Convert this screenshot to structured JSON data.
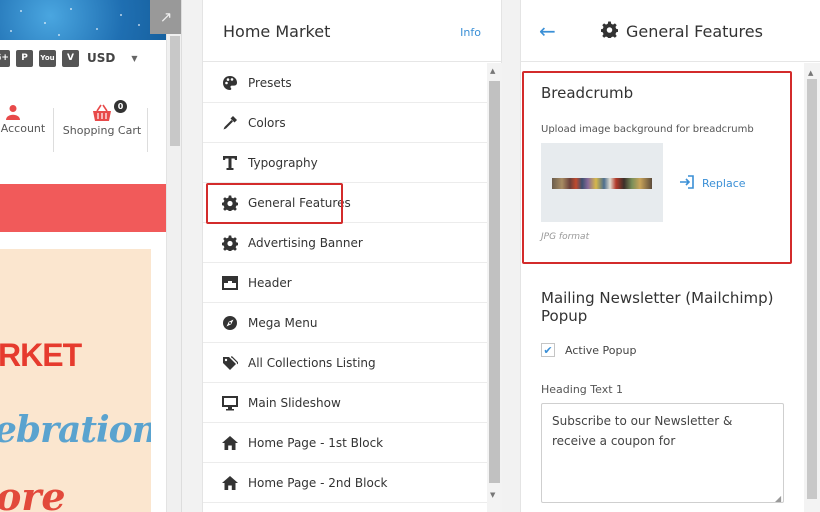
{
  "preview": {
    "expand_icon": "expand-arrow-icon",
    "currency": "USD",
    "social_icons": [
      "google-plus-icon",
      "pinterest-icon",
      "youtube-icon",
      "vimeo-icon"
    ],
    "account_label": "Account",
    "cart_label": "Shopping Cart",
    "cart_count": "0",
    "poster": {
      "line1": "RKET",
      "line2": "ebration",
      "line3": "ore"
    }
  },
  "menu": {
    "title": "Home Market",
    "info_link": "Info",
    "items": [
      {
        "label": "Presets",
        "icon": "palette-icon"
      },
      {
        "label": "Colors",
        "icon": "eyedropper-icon"
      },
      {
        "label": "Typography",
        "icon": "typography-icon"
      },
      {
        "label": "General Features",
        "icon": "gear-icon"
      },
      {
        "label": "Advertising Banner",
        "icon": "gear-icon"
      },
      {
        "label": "Header",
        "icon": "header-icon"
      },
      {
        "label": "Mega Menu",
        "icon": "compass-icon"
      },
      {
        "label": "All Collections Listing",
        "icon": "tags-icon"
      },
      {
        "label": "Main Slideshow",
        "icon": "monitor-icon"
      },
      {
        "label": "Home Page - 1st Block",
        "icon": "home-icon"
      },
      {
        "label": "Home Page - 2nd Block",
        "icon": "home-icon"
      }
    ]
  },
  "general_features": {
    "title": "General Features",
    "breadcrumb": {
      "title": "Breadcrumb",
      "description": "Upload image background for breadcrumb",
      "replace_label": "Replace",
      "format_note": "JPG format"
    },
    "newsletter": {
      "title": "Mailing Newsletter (Mailchimp) Popup",
      "active_popup_label": "Active Popup",
      "active_popup_checked": true,
      "heading_label": "Heading Text 1",
      "heading_value": "Subscribe to our Newsletter & receive a coupon for"
    }
  },
  "colors": {
    "accent": "#3a8fd6",
    "highlight": "#d32b2b",
    "promo_bar": "#f15a5a"
  }
}
